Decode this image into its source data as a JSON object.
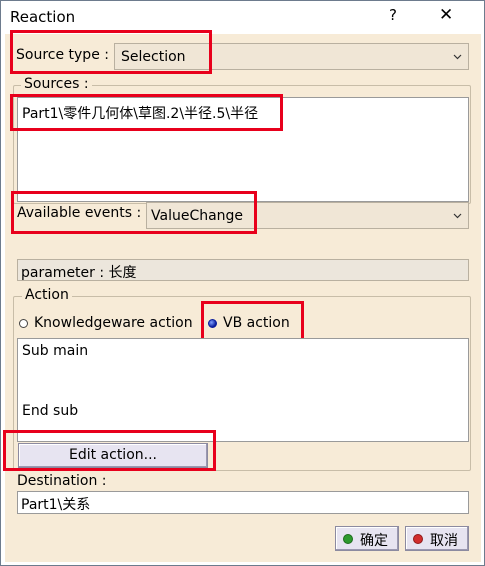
{
  "window": {
    "title": "Reaction",
    "help": "?",
    "close": "✕"
  },
  "source_type": {
    "label": "Source type :",
    "value": "Selection"
  },
  "sources": {
    "label": "Sources :",
    "items": [
      "Part1\\零件几何体\\草图.2\\半径.5\\半径"
    ]
  },
  "events": {
    "label": "Available events :",
    "value": "ValueChange"
  },
  "parameter": {
    "text": "parameter : 长度"
  },
  "action": {
    "label": "Action",
    "radio_knowledgeware": "Knowledgeware action",
    "radio_vb": "VB action",
    "selected": "VB action",
    "code": [
      "Sub main",
      "",
      "",
      "End sub"
    ],
    "edit_button": "Edit action..."
  },
  "destination": {
    "label": "Destination :",
    "value": "Part1\\关系"
  },
  "buttons": {
    "ok": "确定",
    "cancel": "取消"
  },
  "colors": {
    "highlight": "#e8001c",
    "ok_icon": "#2e9a2e",
    "cancel_icon": "#d22d2d",
    "panel": "#f7ebd7"
  }
}
